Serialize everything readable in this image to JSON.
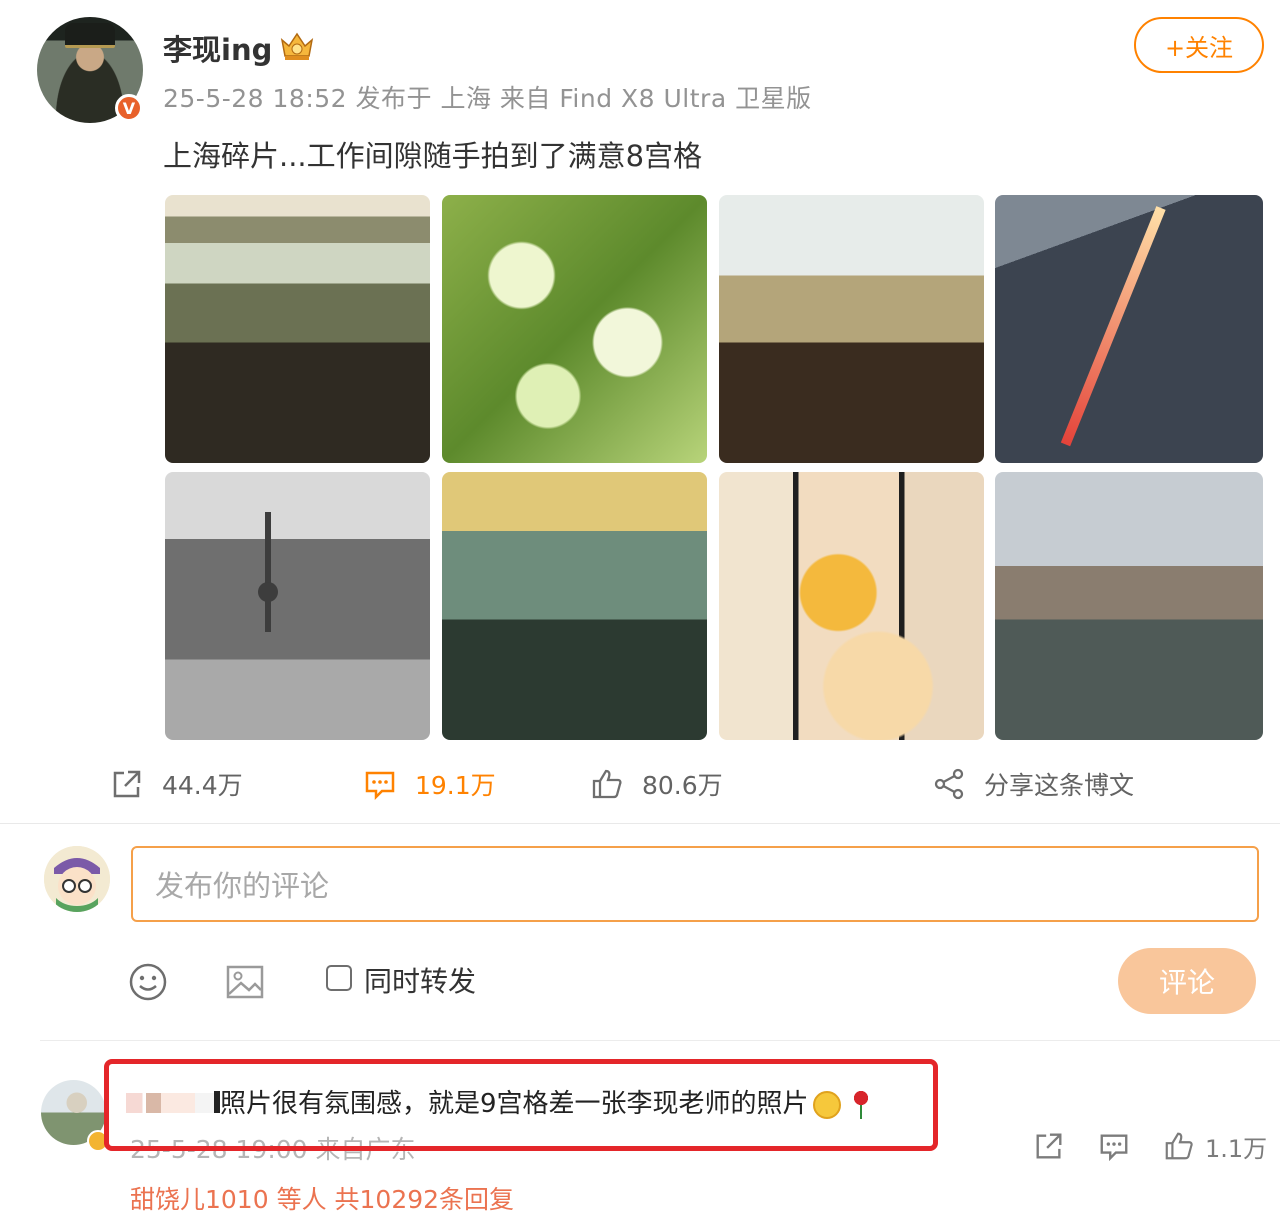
{
  "post": {
    "username": "李现ing",
    "meta": "25-5-28 18:52 发布于 上海 来自 Find X8 Ultra 卫星版",
    "text": "上海碎片...工作间隙随手拍到了满意8宫格",
    "follow_label": "+关注",
    "verified_badge": "V"
  },
  "actions": {
    "repost_count": "44.4万",
    "comment_count": "19.1万",
    "like_count": "80.6万",
    "share_label": "分享这条博文"
  },
  "composer": {
    "placeholder": "发布你的评论",
    "checkbox_label": "同时转发",
    "submit_label": "评论"
  },
  "comment": {
    "text": "照片很有氛围感，就是9宫格差一张李现老师的照片",
    "meta": "25-5-28 19:00 来自广东",
    "like_count": "1.1万",
    "reply_line": "甜饶儿1010 等人  共10292条回复"
  },
  "colors": {
    "accent": "#ff8200",
    "highlight_border": "#e4262a",
    "submit_disabled": "#f9c69b"
  }
}
